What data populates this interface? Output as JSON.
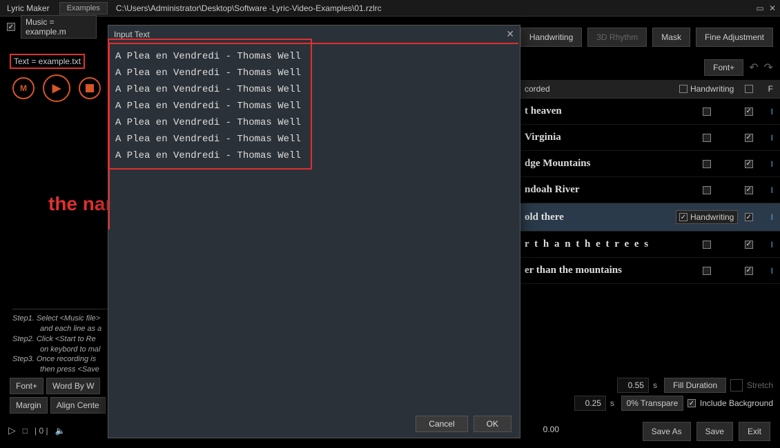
{
  "titlebar": {
    "appname": "Lyric Maker",
    "examples": "Examples",
    "path": "C:\\Users\\Administrator\\Desktop\\Software -Lyric-Video-Examples\\01.rzlrc"
  },
  "top": {
    "music": "Music = example.m",
    "text": "Text = example.txt",
    "handwriting": "Handwriting",
    "rhythm3d": "3D Rhythm",
    "mask": "Mask",
    "fineadj": "Fine Adjustment",
    "fontplus": "Font+"
  },
  "play": {
    "m": "M",
    "play": "▶",
    "stop": "■"
  },
  "annotation": "the name scrolling in the middle part",
  "steps": {
    "s1": "Step1. Select <Music file>",
    "s1b": "and each line as a",
    "s2": "Step2. Click <Start to Re",
    "s2b": "on keybord to mal",
    "s3": "Step3. Once recording is",
    "s3b": "then press <Save"
  },
  "bottom_left": {
    "fontplus": "Font+",
    "wordbyw": "Word By W",
    "margin": "Margin",
    "aligncenter": "Align Cente"
  },
  "timeline": {
    "play": "▷",
    "stop": "□",
    "bar": "|",
    "zero": "0",
    "speaker": "🔈"
  },
  "header": {
    "recorded": "corded",
    "handwriting": "Handwriting",
    "f": "F"
  },
  "lyrics": [
    {
      "text": "t heaven",
      "hw_checked": false,
      "hw_label": "",
      "end": true
    },
    {
      "text": "Virginia",
      "hw_checked": false,
      "hw_label": "",
      "end": true
    },
    {
      "text": "dge Mountains",
      "hw_checked": false,
      "hw_label": "",
      "end": true
    },
    {
      "text": "ndoah River",
      "hw_checked": false,
      "hw_label": "",
      "end": true
    },
    {
      "text": "old there",
      "hw_checked": true,
      "hw_label": "Handwriting",
      "end": true,
      "selected": true
    },
    {
      "text": "r t h a n t h e t r e e s",
      "hw_checked": false,
      "hw_label": "",
      "end": true,
      "spaced": true
    },
    {
      "text": "er than the mountains",
      "hw_checked": false,
      "hw_label": "",
      "end": true
    }
  ],
  "bottom_right": {
    "val1": "0.55",
    "unit": "s",
    "fill": "Fill Duration",
    "stretch": "Stretch",
    "val2": "0.25",
    "transparent": "0% Transpare",
    "include_bg": "Include Background"
  },
  "actions": {
    "saveas": "Save As",
    "save": "Save",
    "exit": "Exit"
  },
  "time0": "0.00",
  "dialog": {
    "title": "Input Text",
    "line": "A Plea en Vendredi - Thomas Well",
    "cancel": "Cancel",
    "ok": "OK"
  }
}
